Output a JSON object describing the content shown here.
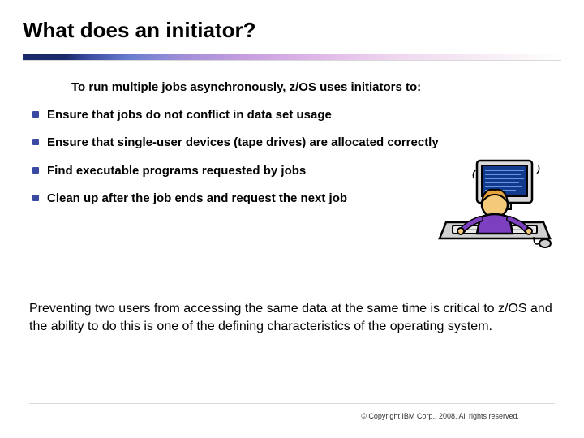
{
  "title": "What does an initiator?",
  "intro": "To run multiple jobs asynchronously, z/OS  uses initiators to:",
  "bullets": [
    "Ensure that jobs do not conflict in data set usage",
    "Ensure that single-user devices (tape drives) are allocated correctly",
    "Find executable programs requested by jobs",
    "Clean up after the job ends and request the next job"
  ],
  "closing": "Preventing two users from accessing the same data at the same time is critical to z/OS and the ability to do this is one of the defining characteristics of the operating system.",
  "copyright": "© Copyright IBM Corp., 2008. All rights reserved.",
  "icon_name": "computer-user-clipart"
}
